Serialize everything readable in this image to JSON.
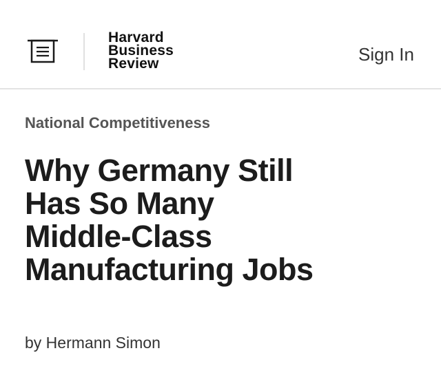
{
  "header": {
    "menu_icon": "menu-icon",
    "logo_lines": [
      "Harvard",
      "Business",
      "Review"
    ],
    "sign_in_label": "Sign In"
  },
  "article": {
    "topic": "National Competitiveness",
    "title": "Why Germany Still Has So Many Middle-Class Manufacturing Jobs",
    "byline": "by Hermann Simon"
  }
}
